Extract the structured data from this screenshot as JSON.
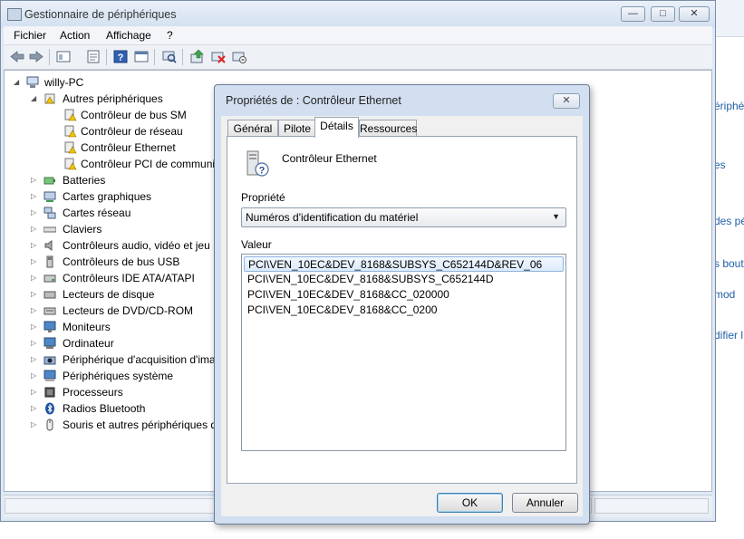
{
  "window": {
    "title": "Gestionnaire de périphériques",
    "buttons": {
      "minimize": "—",
      "maximize": "□",
      "close": "✕"
    }
  },
  "menu": [
    "Fichier",
    "Action",
    "Affichage",
    "?"
  ],
  "toolbar_icons": [
    "back-icon",
    "forward-icon",
    "show-hide-icon",
    "properties-icon",
    "help-icon",
    "view-icon",
    "scan-hardware-icon",
    "update-driver-icon",
    "disable-device-icon",
    "uninstall-device-icon"
  ],
  "tree": {
    "root": "willy-PC",
    "other_devices": {
      "label": "Autres périphériques",
      "children": [
        "Contrôleur de bus SM",
        "Contrôleur de réseau",
        "Contrôleur Ethernet",
        "Contrôleur PCI de communi"
      ]
    },
    "categories": [
      "Batteries",
      "Cartes graphiques",
      "Cartes réseau",
      "Claviers",
      "Contrôleurs audio, vidéo et jeu",
      "Contrôleurs de bus USB",
      "Contrôleurs IDE ATA/ATAPI",
      "Lecteurs de disque",
      "Lecteurs de DVD/CD-ROM",
      "Moniteurs",
      "Ordinateur",
      "Périphérique d'acquisition d'ima",
      "Périphériques système",
      "Processeurs",
      "Radios Bluetooth",
      "Souris et autres périphériques de"
    ]
  },
  "dialog": {
    "title": "Propriétés de : Contrôleur Ethernet",
    "close": "✕",
    "tabs": [
      "Général",
      "Pilote",
      "Détails",
      "Ressources"
    ],
    "active_tab": "Détails",
    "device_name": "Contrôleur Ethernet",
    "property_label": "Propriété",
    "property_selected": "Numéros d'identification du matériel",
    "value_label": "Valeur",
    "values": [
      "PCI\\VEN_10EC&DEV_8168&SUBSYS_C652144D&REV_06",
      "PCI\\VEN_10EC&DEV_8168&SUBSYS_C652144D",
      "PCI\\VEN_10EC&DEV_8168&CC_020000",
      "PCI\\VEN_10EC&DEV_8168&CC_0200"
    ],
    "ok": "OK",
    "cancel": "Annuler"
  },
  "background_fragments": [
    "ériphé",
    "es",
    "des pé",
    "s bout",
    "mod",
    "difier l"
  ]
}
